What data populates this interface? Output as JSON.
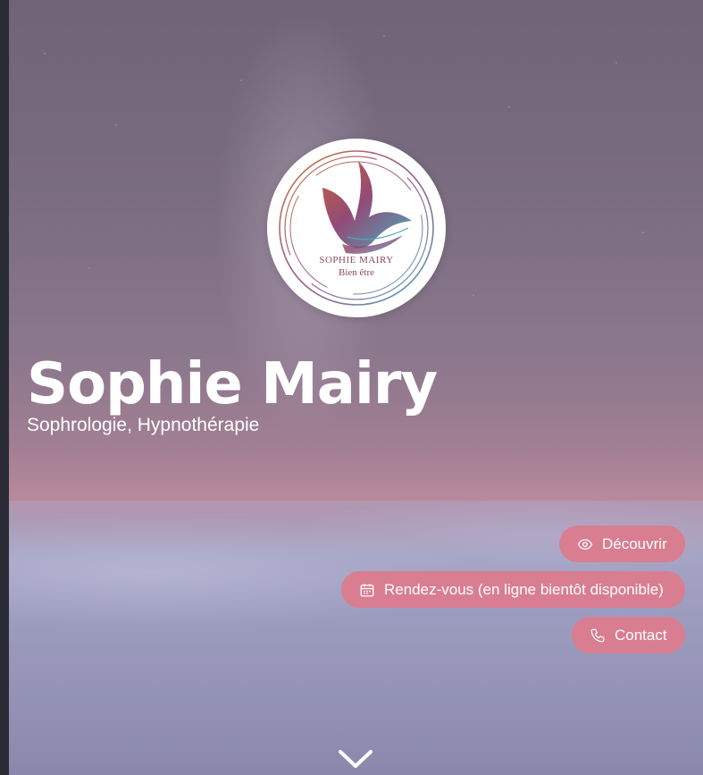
{
  "logo": {
    "name": "SOPHIE MAIRY",
    "tagline": "Bien être"
  },
  "hero": {
    "title": "Sophie Mairy",
    "subtitle": "Sophrologie, Hypnothérapie"
  },
  "buttons": {
    "decouvrir": {
      "label": "Découvrir",
      "icon": "eye-icon"
    },
    "rendezvous": {
      "label": "Rendez-vous (en ligne bientôt disponible)",
      "icon": "calendar-icon"
    },
    "contact": {
      "label": "Contact",
      "icon": "phone-icon"
    }
  },
  "scroll": {
    "icon": "chevron-down-icon"
  },
  "colors": {
    "button": "#d97d91",
    "text": "#ffffff",
    "logo_text": "#8b4b5a"
  }
}
